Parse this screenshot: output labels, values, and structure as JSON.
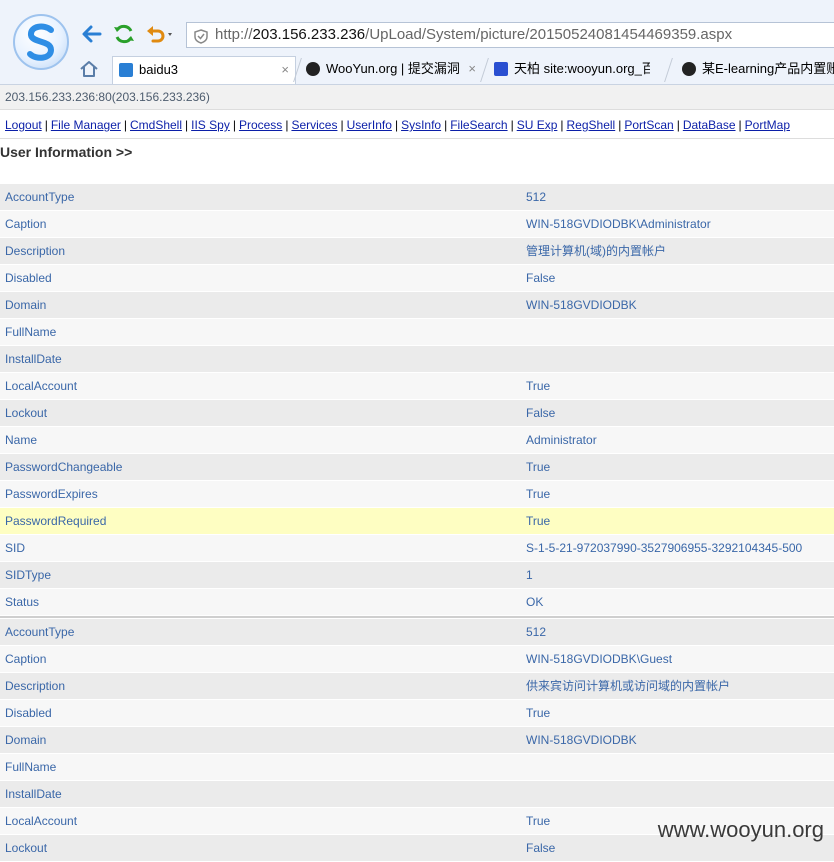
{
  "browser": {
    "url_prefix": "http://",
    "url_host": "203.156.233.236",
    "url_path": "/UpLoad/System/picture/20150524081454469359.aspx",
    "tabs": [
      {
        "label": "baidu3",
        "close": "×",
        "icon_color": "#2a7fd4"
      },
      {
        "label": "WooYun.org | 提交漏洞",
        "close": "×",
        "icon_color": "#222222"
      },
      {
        "label": "天柏 site:wooyun.org_百",
        "close": "",
        "icon_color": "#2a4fd1"
      },
      {
        "label": "某E-learning产品内置账",
        "close": "",
        "icon_color": "#222222"
      }
    ]
  },
  "page": {
    "host_line": "203.156.233.236:80(203.156.233.236)",
    "menu": [
      "Logout",
      "File Manager",
      "CmdShell",
      "IIS Spy",
      "Process",
      "Services",
      "UserInfo",
      "SysInfo",
      "FileSearch",
      "SU Exp",
      "RegShell",
      "PortScan",
      "DataBase",
      "PortMap"
    ],
    "section_title": "User Information >>",
    "user1": [
      {
        "key": "AccountType",
        "value": "512"
      },
      {
        "key": "Caption",
        "value": "WIN-518GVDIODBK\\Administrator"
      },
      {
        "key": "Description",
        "value": "管理计算机(域)的内置帐户"
      },
      {
        "key": "Disabled",
        "value": "False"
      },
      {
        "key": "Domain",
        "value": "WIN-518GVDIODBK"
      },
      {
        "key": "FullName",
        "value": ""
      },
      {
        "key": "InstallDate",
        "value": ""
      },
      {
        "key": "LocalAccount",
        "value": "True"
      },
      {
        "key": "Lockout",
        "value": "False"
      },
      {
        "key": "Name",
        "value": "Administrator"
      },
      {
        "key": "PasswordChangeable",
        "value": "True"
      },
      {
        "key": "PasswordExpires",
        "value": "True"
      },
      {
        "key": "PasswordRequired",
        "value": "True"
      },
      {
        "key": "SID",
        "value": "S-1-5-21-972037990-3527906955-3292104345-500"
      },
      {
        "key": "SIDType",
        "value": "1"
      },
      {
        "key": "Status",
        "value": "OK"
      }
    ],
    "user2": [
      {
        "key": "AccountType",
        "value": "512"
      },
      {
        "key": "Caption",
        "value": "WIN-518GVDIODBK\\Guest"
      },
      {
        "key": "Description",
        "value": "供来宾访问计算机或访问域的内置帐户"
      },
      {
        "key": "Disabled",
        "value": "True"
      },
      {
        "key": "Domain",
        "value": "WIN-518GVDIODBK"
      },
      {
        "key": "FullName",
        "value": ""
      },
      {
        "key": "InstallDate",
        "value": ""
      },
      {
        "key": "LocalAccount",
        "value": "True"
      },
      {
        "key": "Lockout",
        "value": "False"
      }
    ],
    "watermark": "www.wooyun.org"
  },
  "colors": {
    "link": "#0b1fa8",
    "row_text": "#3a67a8",
    "highlight": "#fefec2"
  }
}
